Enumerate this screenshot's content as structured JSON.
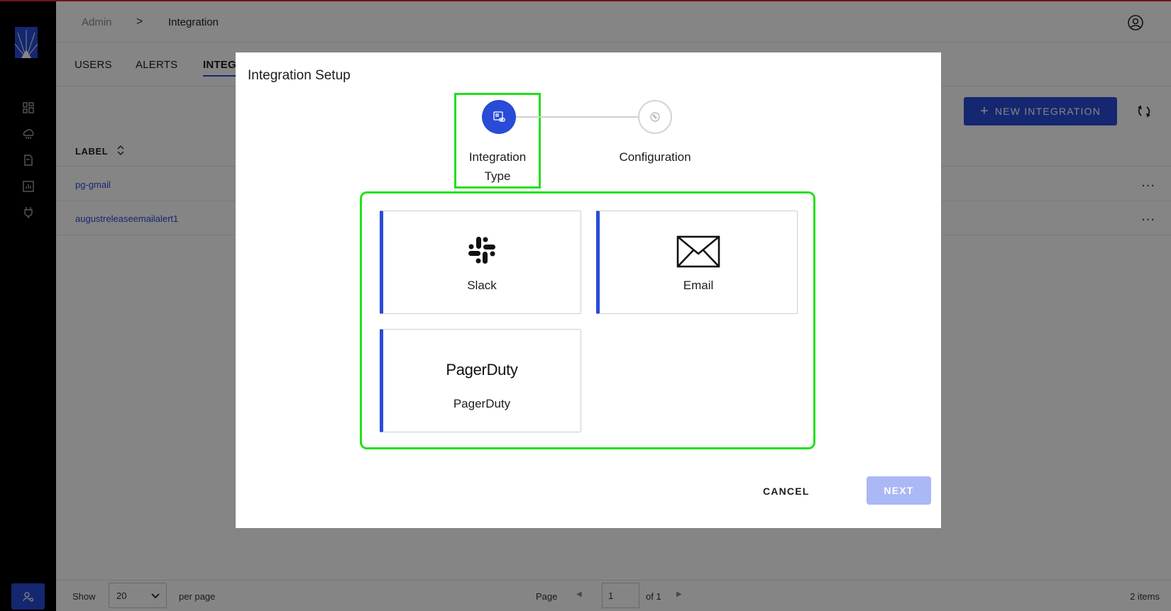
{
  "breadcrumb": {
    "root": "Admin",
    "separator": ">",
    "current": "Integration"
  },
  "tabs": [
    {
      "label": "USERS"
    },
    {
      "label": "ALERTS"
    },
    {
      "label": "INTEGRATIONS"
    }
  ],
  "toolbar": {
    "new_button": "NEW INTEGRATION"
  },
  "table": {
    "column_label": "LABEL",
    "rows": [
      {
        "label": "pg-gmail",
        "actions": "..."
      },
      {
        "label": "augustreleaseemailalert1",
        "actions": "..."
      }
    ]
  },
  "footer": {
    "show": "Show",
    "per_page_value": "20",
    "per_page": "per page",
    "page": "Page",
    "page_value": "1",
    "of_pages": "of 1",
    "items": "2 items"
  },
  "modal": {
    "title": "Integration Setup",
    "steps": [
      {
        "label": "Integration Type",
        "state": "active",
        "icon": "integration-type-icon"
      },
      {
        "label": "Configuration",
        "state": "inactive",
        "icon": "wrench-icon"
      }
    ],
    "options": [
      {
        "name": "Slack",
        "icon": "slack-icon"
      },
      {
        "name": "Email",
        "icon": "envelope-icon"
      },
      {
        "name": "PagerDuty",
        "logo_text": "PagerDuty",
        "icon": "pagerduty-logo"
      }
    ],
    "cancel": "CANCEL",
    "next": "NEXT"
  },
  "colors": {
    "accent": "#2a4bd7",
    "highlight": "#22e01a",
    "next_disabled": "#aab8f5",
    "sidebar": "#000000"
  }
}
